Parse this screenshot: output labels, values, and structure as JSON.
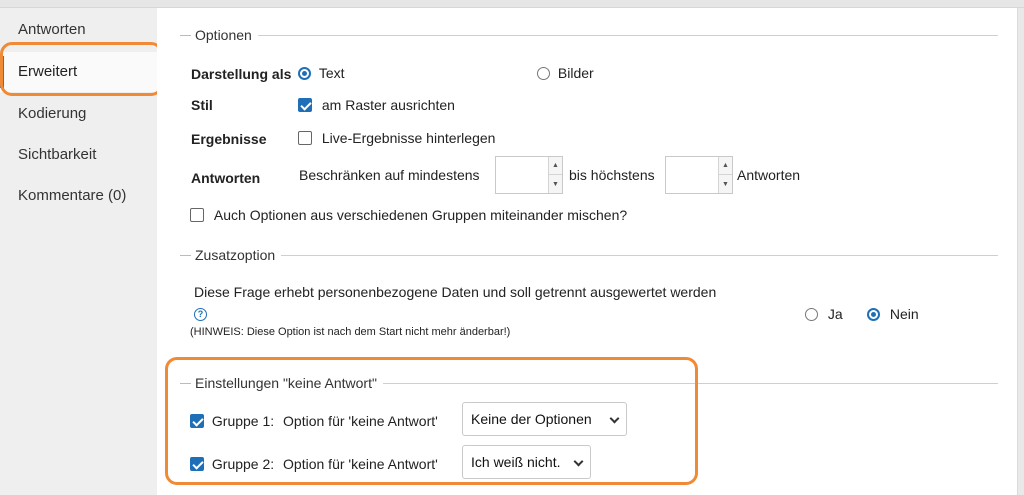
{
  "sidebar": {
    "items": [
      {
        "label": "Antworten"
      },
      {
        "label": "Erweitert"
      },
      {
        "label": "Kodierung"
      },
      {
        "label": "Sichtbarkeit"
      },
      {
        "label": "Kommentare (0)"
      }
    ]
  },
  "optionen": {
    "legend": "Optionen",
    "darstellung_label": "Darstellung als",
    "text_option": "Text",
    "bilder_option": "Bilder",
    "stil_label": "Stil",
    "raster_label": "am Raster ausrichten",
    "ergebnisse_label": "Ergebnisse",
    "live_label": "Live-Ergebnisse hinterlegen",
    "antworten_label": "Antworten",
    "min_prefix": "Beschränken auf mindestens",
    "max_prefix": "bis höchstens",
    "suffix": "Antworten",
    "min_value": "",
    "max_value": "",
    "mischen_label": "Auch Optionen aus verschiedenen Gruppen miteinander mischen?"
  },
  "zusatz": {
    "legend": "Zusatzoption",
    "frage": "Diese Frage erhebt personenbezogene Daten und soll getrennt ausgewertet werden",
    "hinweis": "(HINWEIS: Diese Option ist nach dem Start nicht mehr änderbar!)",
    "ja": "Ja",
    "nein": "Nein",
    "help_glyph": "?"
  },
  "keine": {
    "legend": "Einstellungen \"keine Antwort\"",
    "gruppen": [
      {
        "label": "Gruppe 1:",
        "option_label": "Option für 'keine Antwort'",
        "selected": "Keine der Optionen"
      },
      {
        "label": "Gruppe 2:",
        "option_label": "Option für 'keine Antwort'",
        "selected": "Ich weiß nicht."
      }
    ]
  },
  "colors": {
    "accent": "#1f6fb8",
    "highlight": "#f08a35"
  }
}
